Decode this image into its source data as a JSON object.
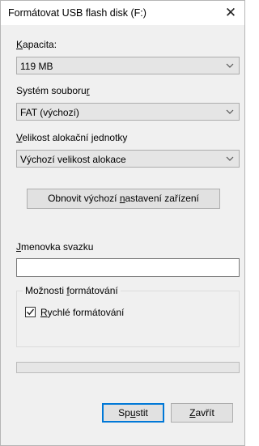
{
  "window": {
    "title": "Formátovat USB flash disk (F:)",
    "close_glyph": "✕"
  },
  "capacity": {
    "label_mnemonic": "K",
    "label_rest": "apacita:",
    "value": "119 MB"
  },
  "filesystem": {
    "label_pre": "Systém souboru",
    "label_mnemonic": "r",
    "label_post": "",
    "value": "FAT (výchozí)"
  },
  "allocation": {
    "label_mnemonic": "V",
    "label_rest": "elikost alokační jednotky",
    "value": "Výchozí velikost alokace"
  },
  "restore_button": {
    "label_pre": "Obnovit výchozí ",
    "label_mnemonic": "n",
    "label_post": "astavení zařízení"
  },
  "volume_label": {
    "label_mnemonic": "J",
    "label_rest": "menovka svazku",
    "value": ""
  },
  "format_options": {
    "group_pre": "Možnosti ",
    "group_mnemonic": "f",
    "group_post": "ormátování",
    "quick_format_mnemonic": "R",
    "quick_format_rest": "ychlé formátování",
    "quick_format_checked": true
  },
  "progress": {
    "value": 0
  },
  "start_button": {
    "label_pre": "Sp",
    "label_mnemonic": "u",
    "label_post": "stit"
  },
  "close_button": {
    "label_mnemonic": "Z",
    "label_rest": "avřít"
  },
  "icons": {
    "dropdown": "chevron-down-icon",
    "checkmark": "checkmark-icon",
    "close": "close-icon"
  },
  "colors": {
    "accent": "#0078d7",
    "dialog_bg": "#f0f0f0",
    "progress_fill": "#06b025"
  }
}
